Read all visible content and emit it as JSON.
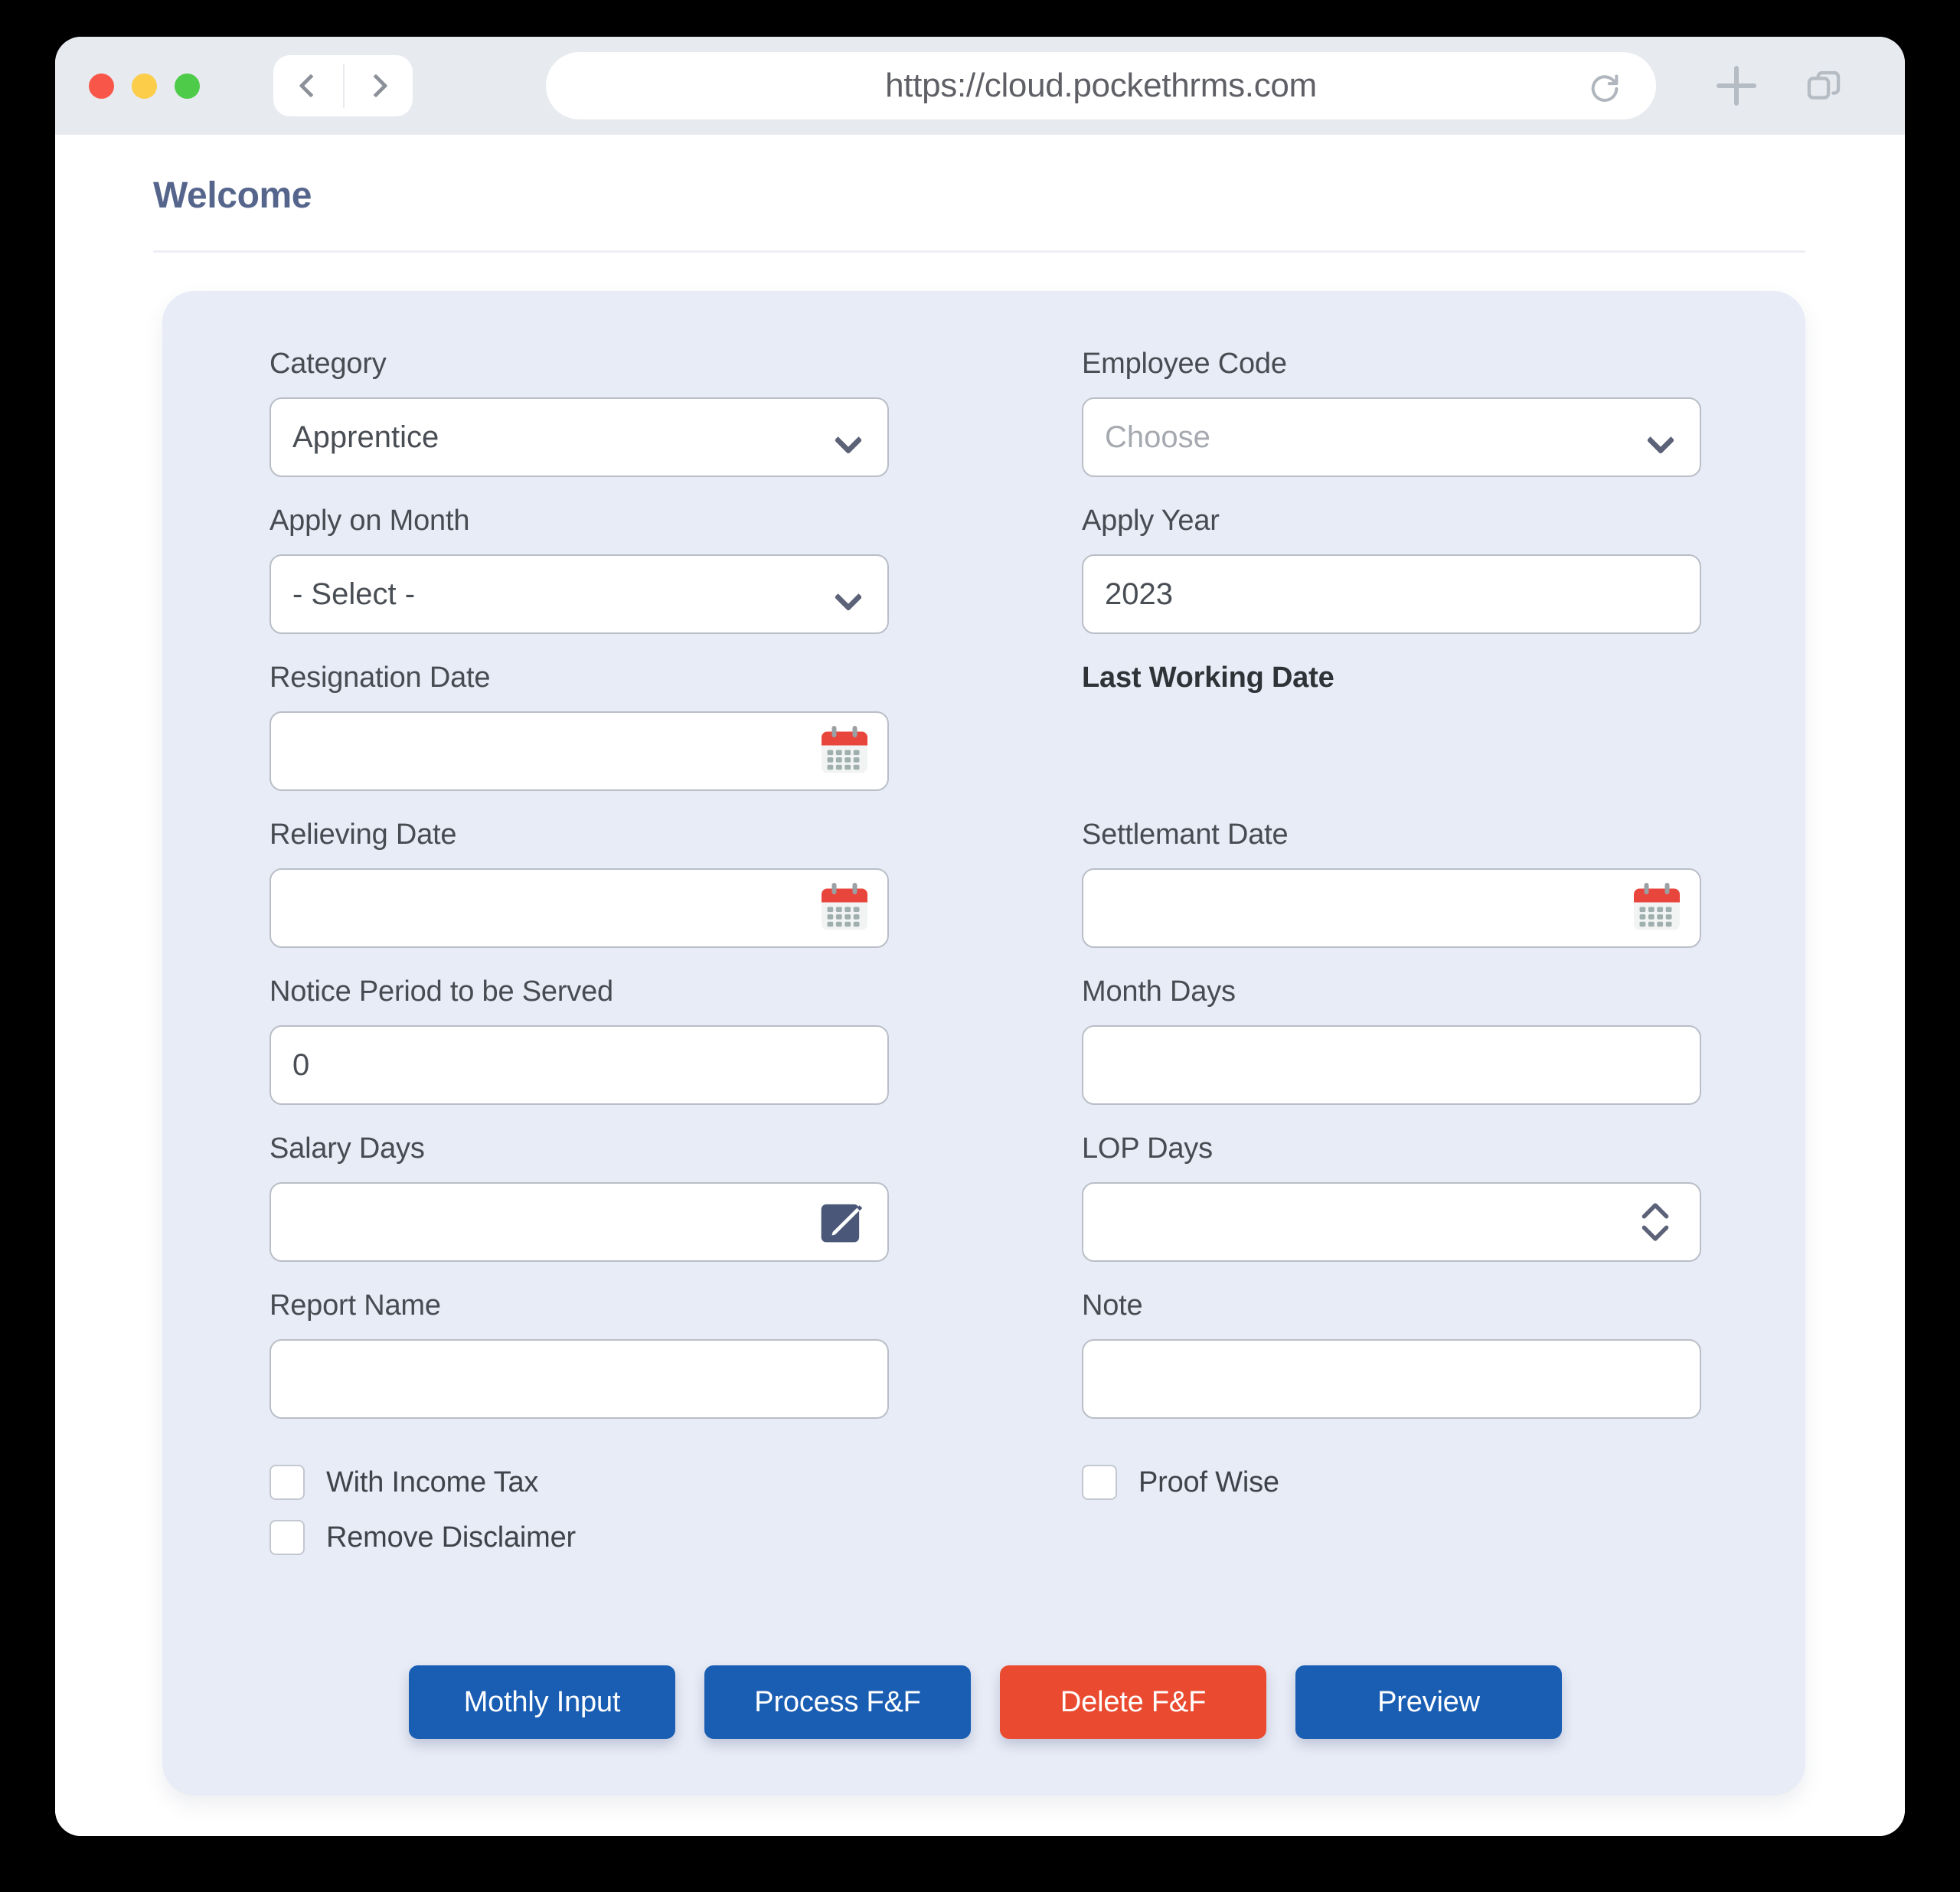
{
  "browser": {
    "url": "https://cloud.pockethrms.com",
    "back_icon": "chevron-left-icon",
    "forward_icon": "chevron-right-icon",
    "reload_icon": "reload-icon",
    "new_tab_icon": "plus-icon",
    "tabs_icon": "tab-overview-icon"
  },
  "page": {
    "title": "Welcome"
  },
  "form": {
    "left": [
      {
        "label": "Category",
        "value": "Apprentice",
        "type": "select",
        "placeholder": ""
      },
      {
        "label": "Apply on Month",
        "value": "- Select -",
        "type": "select",
        "placeholder": ""
      },
      {
        "label": "Resignation Date",
        "value": "",
        "type": "date",
        "placeholder": ""
      },
      {
        "label": "Relieving Date",
        "value": "",
        "type": "date",
        "placeholder": ""
      },
      {
        "label": "Notice Period to be Served",
        "value": "0",
        "type": "text",
        "placeholder": ""
      },
      {
        "label": "Salary Days",
        "value": "",
        "type": "edit",
        "placeholder": ""
      },
      {
        "label": "Report Name",
        "value": "",
        "type": "text",
        "placeholder": ""
      }
    ],
    "right": [
      {
        "label": "Employee Code",
        "value": "Choose",
        "type": "select",
        "is_placeholder": true,
        "placeholder": "Choose"
      },
      {
        "label": "Apply Year",
        "value": "2023",
        "type": "text",
        "is_placeholder": false,
        "placeholder": ""
      },
      {
        "label": "Last Working Date",
        "value": "",
        "type": "none",
        "is_placeholder": false,
        "placeholder": ""
      },
      {
        "label": "Settlemant Date",
        "value": "",
        "type": "date",
        "is_placeholder": false,
        "placeholder": ""
      },
      {
        "label": "Month Days",
        "value": "",
        "type": "text",
        "is_placeholder": false,
        "placeholder": ""
      },
      {
        "label": "LOP Days",
        "value": "",
        "type": "stepper",
        "is_placeholder": false,
        "placeholder": ""
      },
      {
        "label": "Note",
        "value": "",
        "type": "text",
        "is_placeholder": false,
        "placeholder": ""
      }
    ],
    "checkboxes_left": [
      {
        "label": "With Income Tax",
        "checked": false
      },
      {
        "label": "Remove Disclaimer",
        "checked": false
      }
    ],
    "checkboxes_right": [
      {
        "label": "Proof Wise",
        "checked": false
      }
    ]
  },
  "buttons": [
    {
      "label": "Mothly Input",
      "style": "primary"
    },
    {
      "label": "Process F&F",
      "style": "primary"
    },
    {
      "label": "Delete F&F",
      "style": "danger"
    },
    {
      "label": "Preview",
      "style": "primary"
    }
  ],
  "colors": {
    "accent_blue": "#1a5eb3",
    "danger_red": "#ea4b30",
    "card_bg": "#e8ecf6",
    "title_blue": "#55658c",
    "calendar_red": "#e8453c",
    "edit_navy": "#4a5778"
  }
}
